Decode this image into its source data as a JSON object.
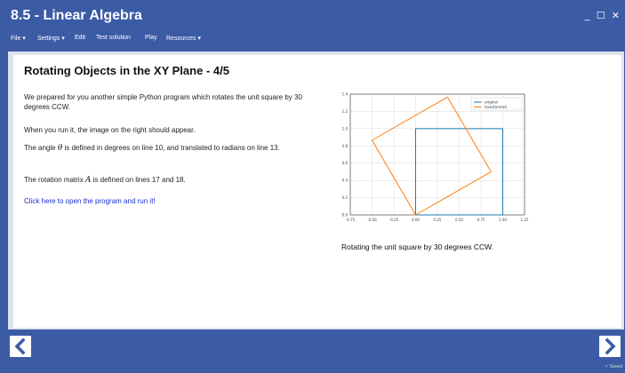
{
  "window": {
    "title": "8.5 - Linear Algebra",
    "controls": {
      "minimize": "_",
      "maximize": "☐",
      "close": "✕"
    }
  },
  "menu": {
    "items": [
      "File ▾",
      "Settings ▾",
      "Edit",
      "Test solution",
      "Play",
      "Resources ▾"
    ]
  },
  "page": {
    "title": "Rotating Objects in the XY Plane - 4/5",
    "p1": "We prepared for you another simple Python program which rotates the unit square by 30 degrees CCW.",
    "p2": "When you run it, the image on the right should appear.",
    "p3_pre": "The angle ",
    "p3_sym": "θ",
    "p3_post": " is defined in degrees on line 10, and translated to radians on line 13.",
    "p4_pre": "The rotation matrix ",
    "p4_sym": "A",
    "p4_post": " is defined on lines 17 and 18.",
    "link": "Click here to open the program and run it!",
    "caption": "Rotating the unit square by 30 degrees CCW."
  },
  "chart_data": {
    "type": "line",
    "xlim": [
      -0.75,
      1.25
    ],
    "ylim": [
      0,
      1.4
    ],
    "xticks": [
      "-0.75",
      "-0.50",
      "-0.25",
      "0.00",
      "0.25",
      "0.50",
      "0.75",
      "1.00",
      "1.25"
    ],
    "yticks": [
      "0.0",
      "0.2",
      "0.4",
      "0.6",
      "0.8",
      "1.0",
      "1.2",
      "1.4"
    ],
    "grid": true,
    "legend": "top-right",
    "series": [
      {
        "name": "original",
        "color": "#1f77b4",
        "x": [
          0,
          1,
          1,
          0,
          0
        ],
        "y": [
          0,
          0,
          1,
          1,
          0
        ]
      },
      {
        "name": "transformed",
        "color": "#ff7f0e",
        "x": [
          0,
          0.866,
          0.366,
          -0.5,
          0
        ],
        "y": [
          0,
          0.5,
          1.366,
          0.866,
          0
        ]
      }
    ]
  },
  "footer": {
    "prev_icon": "arrow-left-icon",
    "next_icon": "arrow-right-icon",
    "status": "✓ Saved"
  }
}
